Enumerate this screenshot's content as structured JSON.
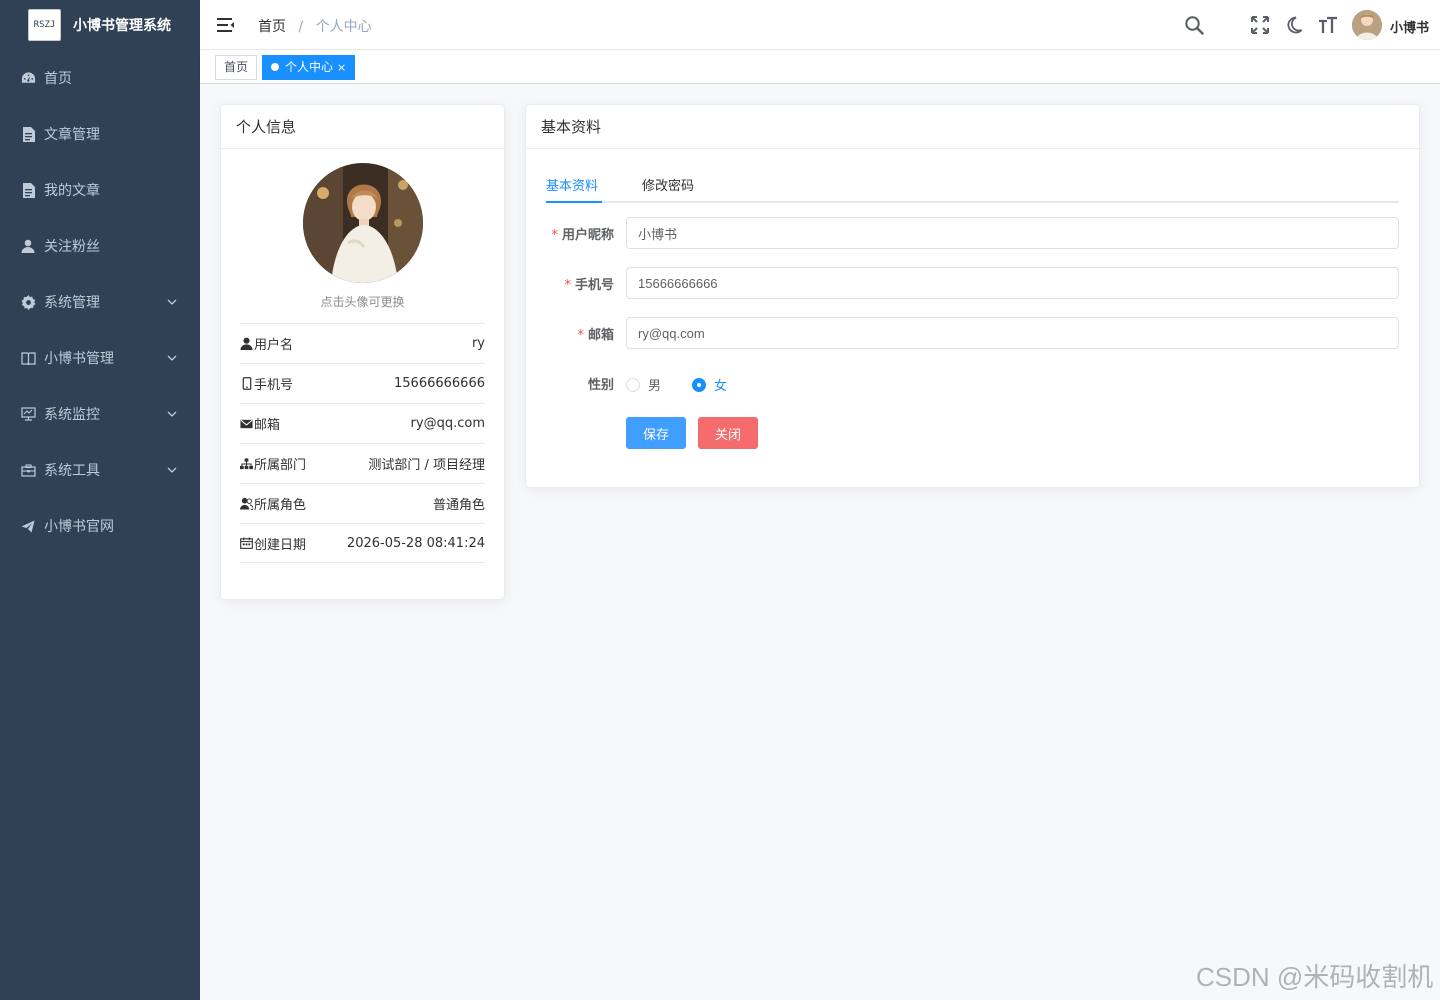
{
  "app": {
    "logo_text": "RSZJ",
    "title": "小博书管理系统"
  },
  "sidebar": {
    "items": [
      {
        "label": "首页",
        "icon": "dashboard-icon",
        "expandable": false
      },
      {
        "label": "文章管理",
        "icon": "document-icon",
        "expandable": false
      },
      {
        "label": "我的文章",
        "icon": "document-icon",
        "expandable": false
      },
      {
        "label": "关注粉丝",
        "icon": "user-icon",
        "expandable": false
      },
      {
        "label": "系统管理",
        "icon": "gear-icon",
        "expandable": true
      },
      {
        "label": "小博书管理",
        "icon": "book-icon",
        "expandable": true
      },
      {
        "label": "系统监控",
        "icon": "monitor-icon",
        "expandable": true
      },
      {
        "label": "系统工具",
        "icon": "toolbox-icon",
        "expandable": true
      },
      {
        "label": "小博书官网",
        "icon": "send-icon",
        "expandable": false
      }
    ]
  },
  "navbar": {
    "breadcrumb": {
      "home": "首页",
      "separator": "/",
      "current": "个人中心"
    },
    "username": "小博书"
  },
  "tags": [
    {
      "label": "首页",
      "active": false
    },
    {
      "label": "个人中心",
      "active": true,
      "close": "×"
    }
  ],
  "profile_card": {
    "title": "个人信息",
    "avatar_tip": "点击头像可更换",
    "rows": [
      {
        "label": "用户名",
        "value": "ry",
        "icon": "user-icon"
      },
      {
        "label": "手机号",
        "value": "15666666666",
        "icon": "phone-icon"
      },
      {
        "label": "邮箱",
        "value": "ry@qq.com",
        "icon": "mail-icon"
      },
      {
        "label": "所属部门",
        "value": "测试部门 / 项目经理",
        "icon": "tree-icon"
      },
      {
        "label": "所属角色",
        "value": "普通角色",
        "icon": "peoples-icon"
      },
      {
        "label": "创建日期",
        "value": "2026-05-28 08:41:24",
        "icon": "date-icon"
      }
    ]
  },
  "basic_card": {
    "title": "基本资料",
    "tabs": [
      {
        "label": "基本资料",
        "active": true
      },
      {
        "label": "修改密码",
        "active": false
      }
    ],
    "form": {
      "nickname": {
        "label": "用户昵称",
        "value": "小博书",
        "required": "*"
      },
      "phone": {
        "label": "手机号",
        "value": "15666666666",
        "required": "*"
      },
      "email": {
        "label": "邮箱",
        "value": "ry@qq.com",
        "required": "*"
      },
      "gender": {
        "label": "性别",
        "options": [
          "男",
          "女"
        ],
        "selected": "女"
      }
    },
    "buttons": {
      "save": "保存",
      "close": "关闭"
    }
  },
  "watermark": "CSDN @米码收割机",
  "colors": {
    "sidebar_bg": "#304156",
    "primary": "#1890ff",
    "danger": "#f56c6c"
  }
}
